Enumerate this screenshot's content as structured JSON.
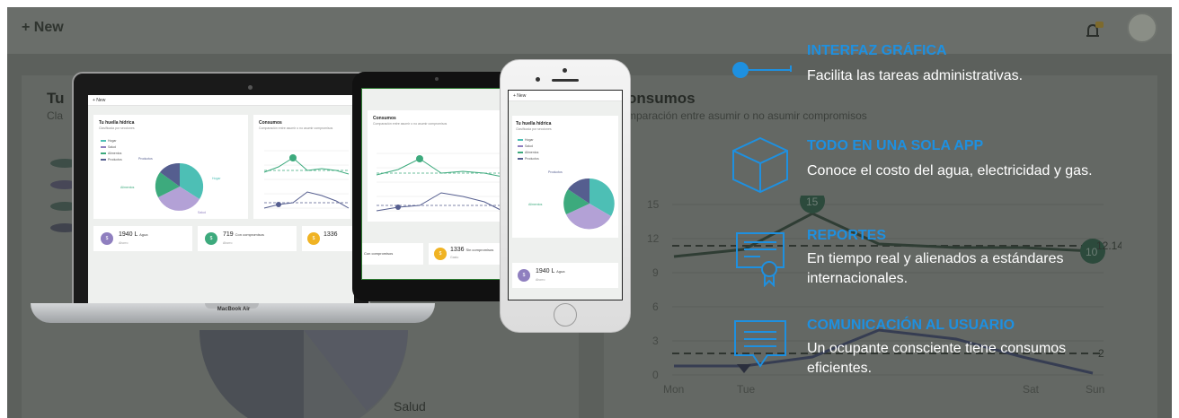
{
  "background": {
    "new_label": "New",
    "left_title": "Tu",
    "left_subtitle": "Cla",
    "right_title": "onsumos",
    "right_subtitle": "mparación entre asumir o no asumir compromisos",
    "chart_y_labels": [
      "15",
      "12",
      "9",
      "6",
      "3",
      "0"
    ],
    "chart_x_labels": [
      "Mon",
      "Tue",
      "Sat",
      "Sun"
    ],
    "chart_point_labels": [
      "15",
      "10",
      "12.14",
      "2"
    ],
    "pie_label": "Salud"
  },
  "mockup": {
    "new_label": "+ New",
    "huella_title": "Tu huella hídrica",
    "huella_sub": "Clasificada por secciones",
    "legend": [
      "Hogar",
      "Salud",
      "Alimentos",
      "Productos"
    ],
    "pie_labels": [
      "Productos",
      "Hogar",
      "Alimentos",
      "Salud"
    ],
    "consumos_title": "Consumos",
    "consumos_sub": "Comparación entre asumir o no asumir compromisos",
    "stats": [
      {
        "icon": "$",
        "value": "1940 L",
        "unit": "Agua",
        "label": "Ahorro"
      },
      {
        "icon": "$",
        "value": "719",
        "unit": "Con compromisos",
        "label": "Ahorro"
      },
      {
        "icon": "$",
        "value": "1336",
        "unit": "Sin compromisos",
        "label": "Gasto"
      }
    ],
    "laptop_brand": "MacBook Air"
  },
  "features": [
    {
      "title": "INTERFAZ GRÁFICA",
      "desc": "Facilita las tareas administrativas."
    },
    {
      "title": "TODO EN UNA SOLA APP",
      "desc": "Conoce el costo del agua, electricidad y gas."
    },
    {
      "title": "REPORTES",
      "desc": "En tiempo real y alienados a estándares internacionales."
    },
    {
      "title": "COMUNICACIÓN AL USUARIO",
      "desc": "Un ocupante consciente tiene consumos eficientes."
    }
  ],
  "colors": {
    "accent_blue": "#1e90e0",
    "teal": "#4dbfb5",
    "purple": "#8f7fbf",
    "green": "#3daa7d",
    "navy": "#555e8f",
    "amber": "#f0b323"
  }
}
